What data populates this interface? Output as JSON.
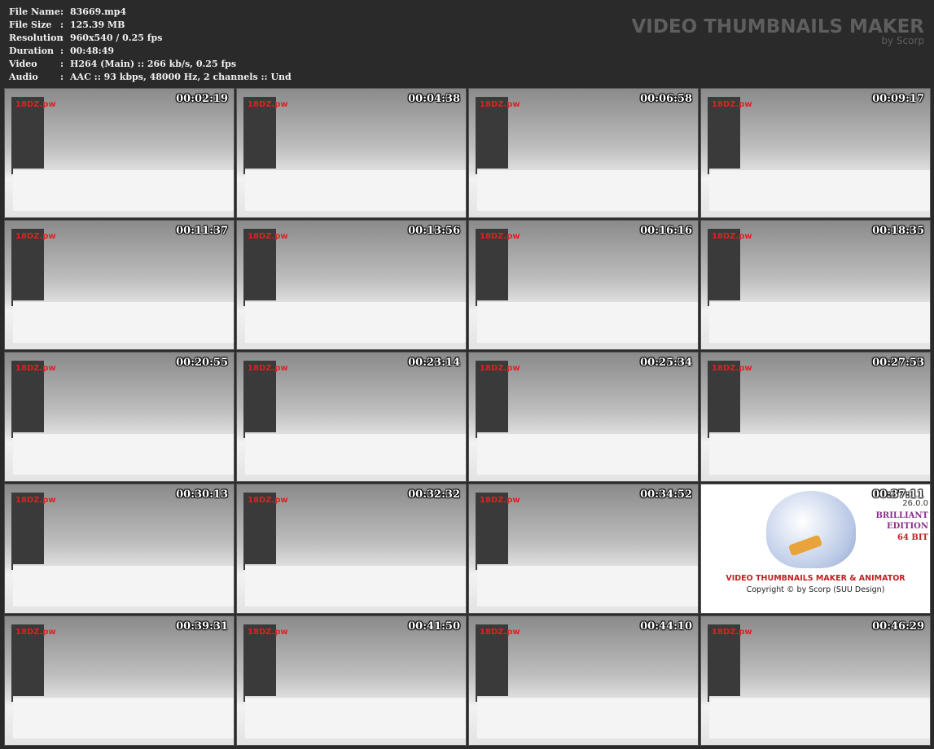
{
  "info": [
    {
      "key": "File Name",
      "value": "83669.mp4"
    },
    {
      "key": "File Size",
      "value": "125.39 MB"
    },
    {
      "key": "Resolution",
      "value": "960x540 / 0.25 fps"
    },
    {
      "key": "Duration",
      "value": "00:48:49"
    },
    {
      "key": "Video",
      "value": "H264 (Main) :: 266 kb/s, 0.25 fps"
    },
    {
      "key": "Audio",
      "value": "AAC :: 93 kbps, 48000 Hz, 2 channels :: Und"
    }
  ],
  "sep": ":",
  "brand": {
    "title": "VIDEO THUMBNAILS MAKER",
    "by": "by Scorp"
  },
  "watermark": "18DZ.pw",
  "thumbs": [
    "00:02:19",
    "00:04:38",
    "00:06:58",
    "00:09:17",
    "00:11:37",
    "00:13:56",
    "00:16:16",
    "00:18:35",
    "00:20:55",
    "00:23:14",
    "00:25:34",
    "00:27:53",
    "00:30:13",
    "00:32:32",
    "00:34:52",
    "00:37:11",
    "00:39:31",
    "00:41:50",
    "00:44:10",
    "00:46:29"
  ],
  "logo_index": 15,
  "logo": {
    "version": "26.0.0",
    "edition1": "BRILLIANT",
    "edition2": "EDITION",
    "bits": "64 BIT",
    "name": "VIDEO THUMBNAILS MAKER & ANIMATOR",
    "copyright": "Copyright © by Scorp (SUU Design)"
  }
}
